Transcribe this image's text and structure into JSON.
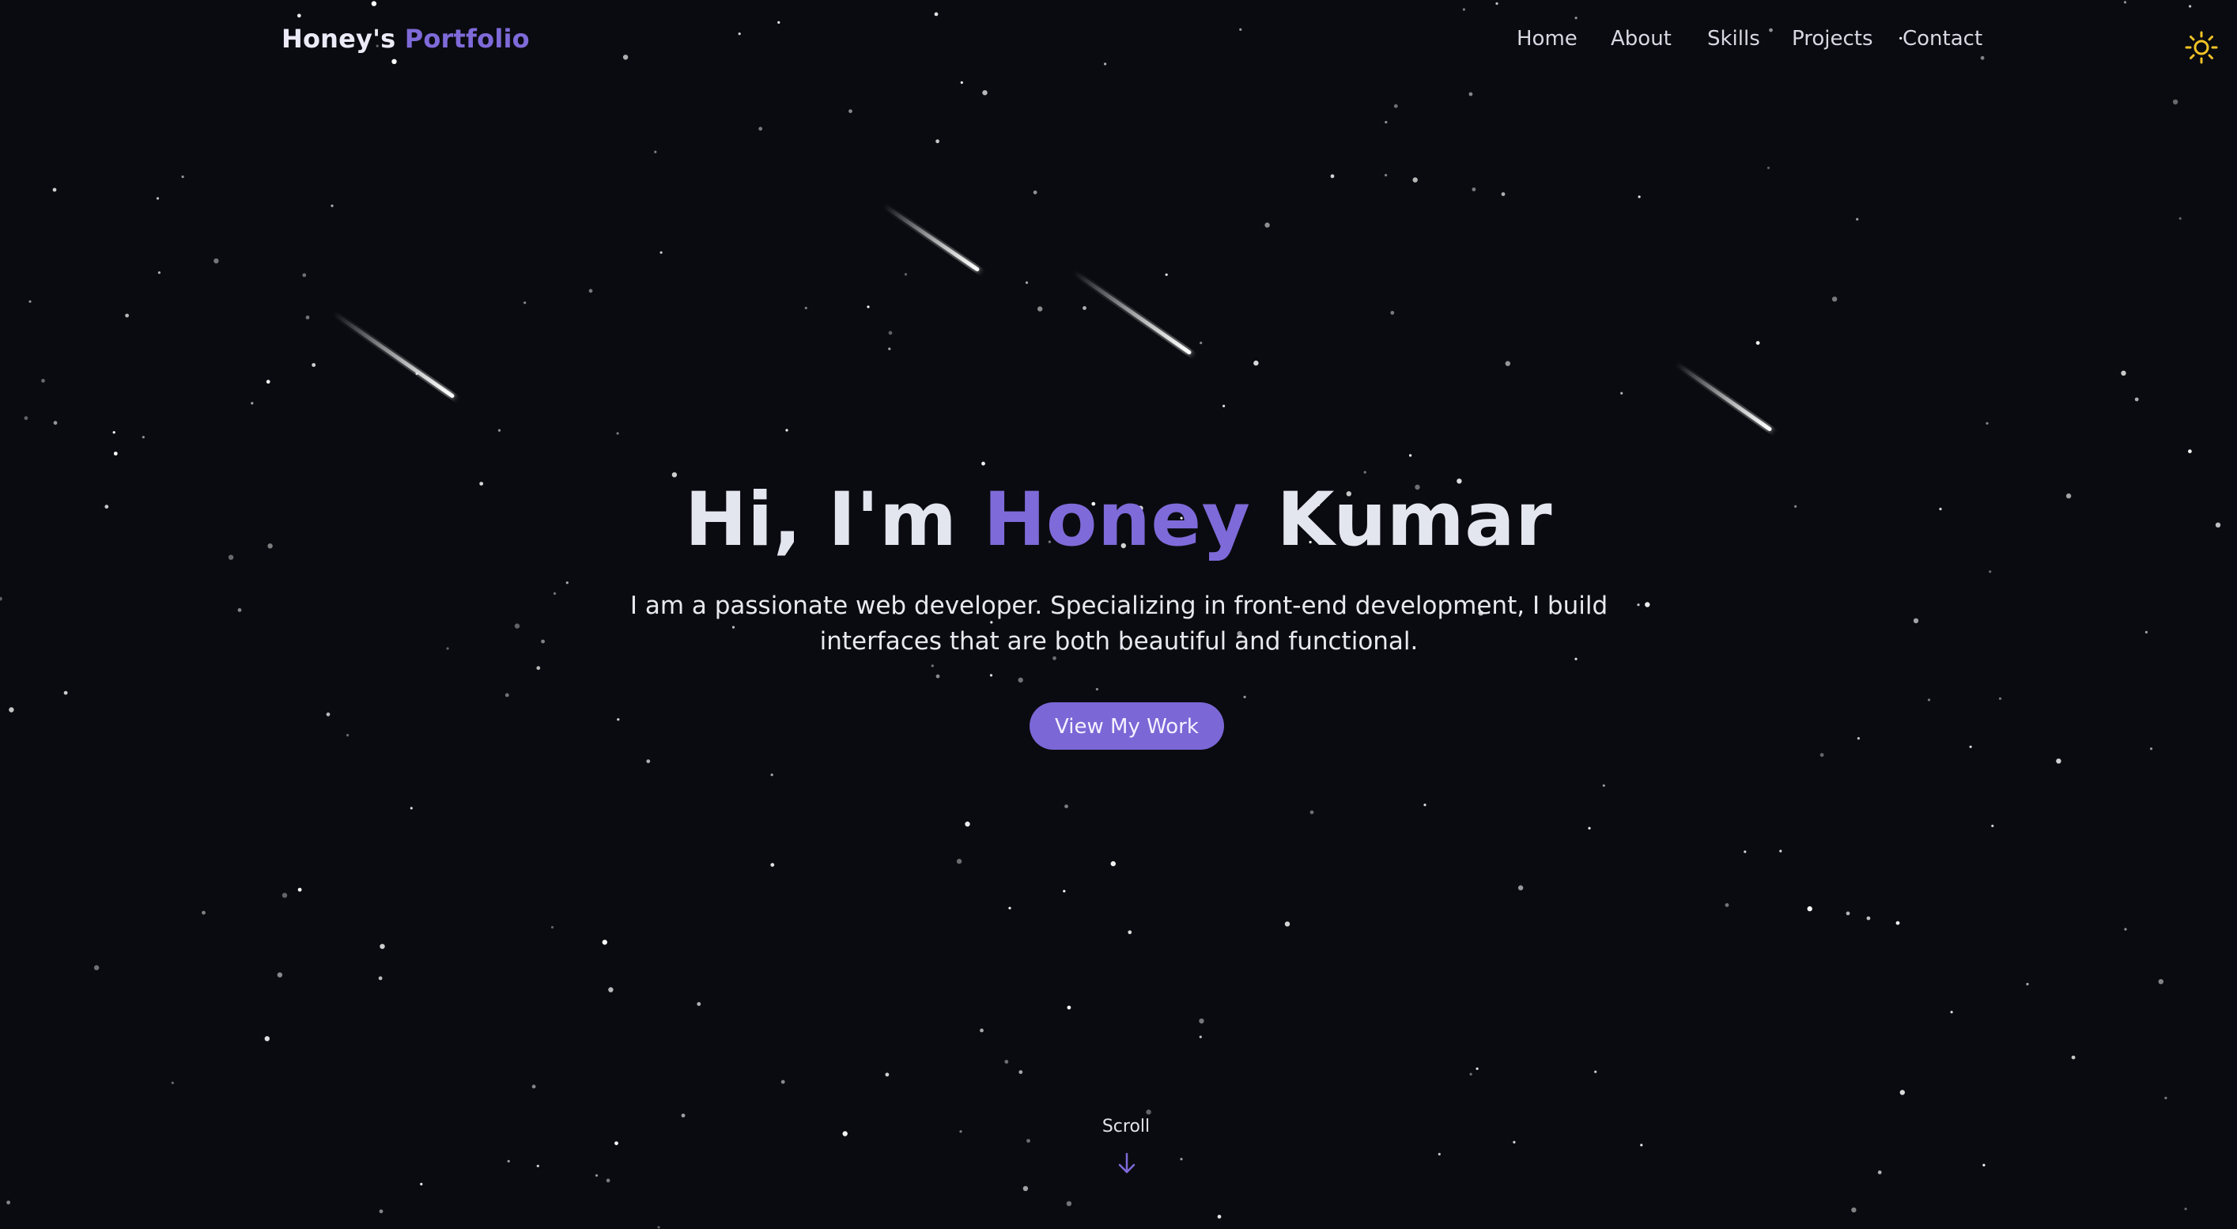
{
  "nav": {
    "logo_main": "Honey's",
    "logo_accent": "Portfolio",
    "links": [
      "Home",
      "About",
      "Skills",
      "Projects",
      "Contact"
    ],
    "theme_icon": "sun-icon"
  },
  "hero": {
    "title_prefix": "Hi, I'm",
    "title_first": "Honey",
    "title_last": "Kumar",
    "subtitle": "I am a passionate web developer. Specializing in front-end development, I build interfaces that are both beautiful and functional.",
    "cta_label": "View My Work"
  },
  "scroll": {
    "label": "Scroll",
    "icon": "arrow-down-icon"
  },
  "colors": {
    "background": "#0a0b10",
    "accent": "#7f6ad9",
    "text": "#e4e6ef",
    "sun": "#f2c326"
  }
}
